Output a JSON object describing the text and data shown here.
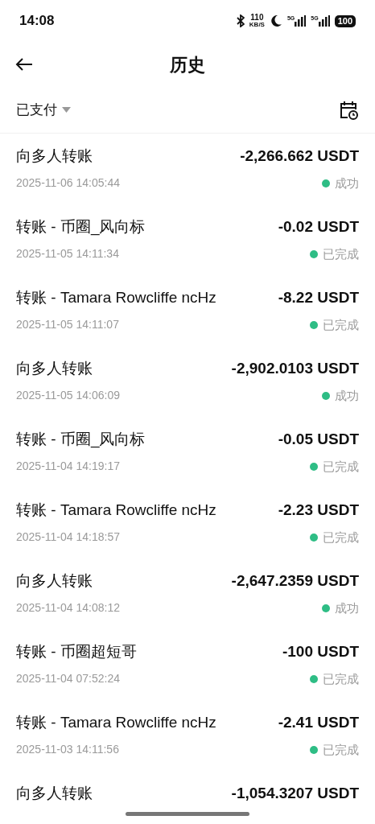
{
  "status_bar": {
    "time": "14:08",
    "speed": "110",
    "speed_unit": "KB/S",
    "network_1": "5G",
    "network_2": "5G",
    "battery": "100"
  },
  "header": {
    "title": "历史"
  },
  "filter": {
    "label": "已支付"
  },
  "transactions": [
    {
      "title": "向多人转账",
      "amount": "-2,266.662 USDT",
      "date": "2025-11-06 14:05:44",
      "status": "成功"
    },
    {
      "title": "转账 - 币圈_风向标",
      "amount": "-0.02 USDT",
      "date": "2025-11-05 14:11:34",
      "status": "已完成"
    },
    {
      "title": "转账 - Tamara Rowcliffe ncHz",
      "amount": "-8.22 USDT",
      "date": "2025-11-05 14:11:07",
      "status": "已完成"
    },
    {
      "title": "向多人转账",
      "amount": "-2,902.0103 USDT",
      "date": "2025-11-05 14:06:09",
      "status": "成功"
    },
    {
      "title": "转账 - 币圈_风向标",
      "amount": "-0.05 USDT",
      "date": "2025-11-04 14:19:17",
      "status": "已完成"
    },
    {
      "title": "转账 - Tamara Rowcliffe ncHz",
      "amount": "-2.23 USDT",
      "date": "2025-11-04 14:18:57",
      "status": "已完成"
    },
    {
      "title": "向多人转账",
      "amount": "-2,647.2359 USDT",
      "date": "2025-11-04 14:08:12",
      "status": "成功"
    },
    {
      "title": "转账 - 币圈超短哥",
      "amount": "-100 USDT",
      "date": "2025-11-04 07:52:24",
      "status": "已完成"
    },
    {
      "title": "转账 - Tamara Rowcliffe ncHz",
      "amount": "-2.41 USDT",
      "date": "2025-11-03 14:11:56",
      "status": "已完成"
    },
    {
      "title": "向多人转账",
      "amount": "-1,054.3207 USDT"
    }
  ]
}
